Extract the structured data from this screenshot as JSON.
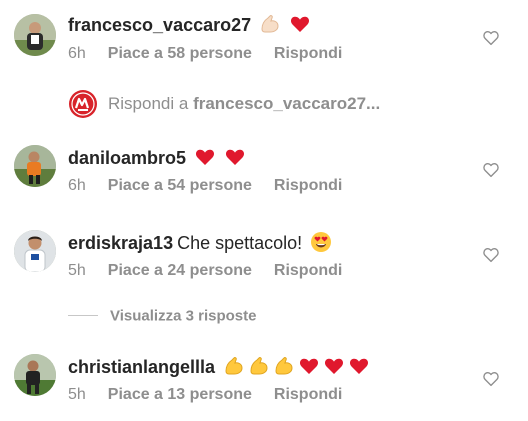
{
  "comments": [
    {
      "username": "francesco_vaccaro27",
      "text": "",
      "emoji": [
        "flexed-biceps-light",
        "red-heart"
      ],
      "time": "6h",
      "likes": "Piace a 58 persone",
      "reply": "Rispondi"
    },
    {
      "username": "daniloambro5",
      "text": "",
      "emoji": [
        "red-heart",
        "red-heart"
      ],
      "time": "6h",
      "likes": "Piace a 54 persone",
      "reply": "Rispondi"
    },
    {
      "username": "erdiskraja13",
      "text": "Che spettacolo!",
      "emoji": [
        "heart-eyes-face"
      ],
      "time": "5h",
      "likes": "Piace a 24 persone",
      "reply": "Rispondi"
    },
    {
      "username": "christianlangellla",
      "text": "",
      "emoji": [
        "flexed-biceps",
        "flexed-biceps",
        "flexed-biceps",
        "red-heart",
        "red-heart",
        "red-heart"
      ],
      "time": "5h",
      "likes": "Piace a 13 persone",
      "reply": "Rispondi"
    }
  ],
  "reply_to": {
    "prefix": "Rispondi a",
    "username": "francesco_vaccaro27..."
  },
  "view_replies": {
    "label": "Visualizza 3 risposte"
  },
  "colors": {
    "text": "#262626",
    "secondary": "#8e8e8e",
    "heart_emoji": "#e0182d",
    "biceps_emoji": "#ffc83d",
    "biceps_light_emoji": "#f7dec8"
  }
}
